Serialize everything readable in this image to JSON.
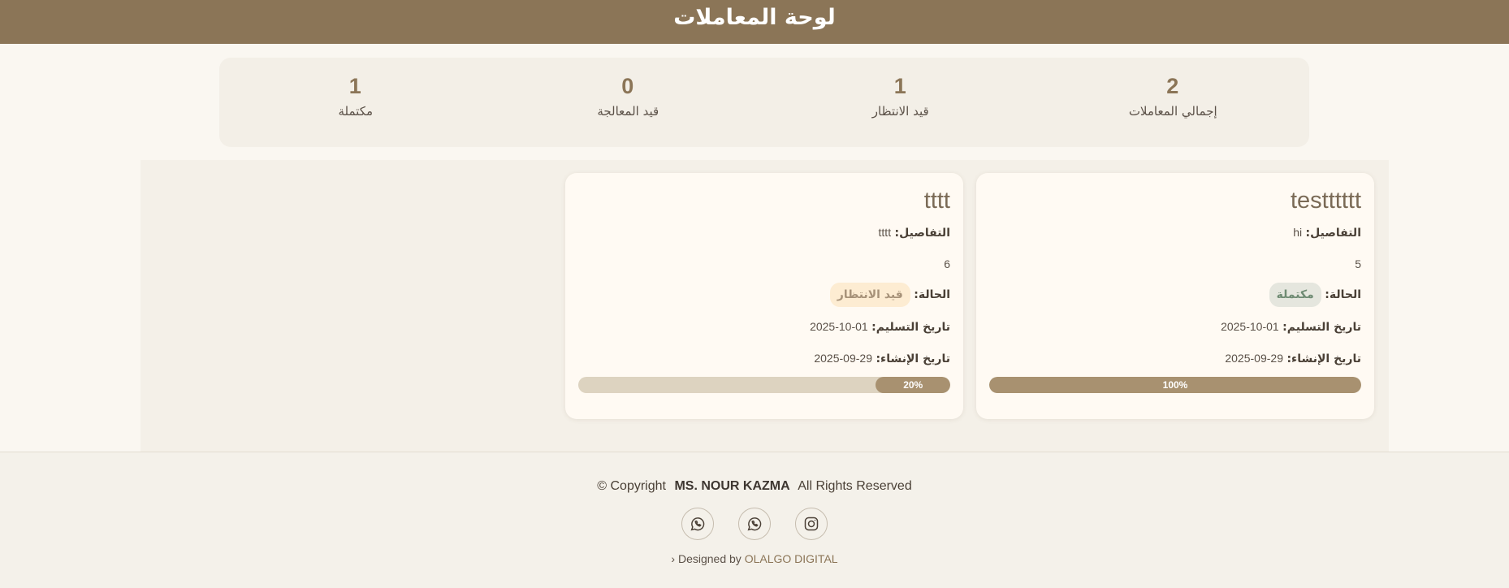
{
  "header": {
    "title": "لوحة المعاملات"
  },
  "stats": [
    {
      "value": "2",
      "label": "إجمالي المعاملات"
    },
    {
      "value": "1",
      "label": "قيد الانتظار"
    },
    {
      "value": "0",
      "label": "قيد المعالجة"
    },
    {
      "value": "1",
      "label": "مكتملة"
    }
  ],
  "cards": [
    {
      "title": "testttttt",
      "details_label": "التفاصيل:",
      "details_value": "hi",
      "number": "5",
      "status_label": "الحالة:",
      "status": "مكتملة",
      "status_kind": "done",
      "delivery_label": "تاريخ التسليم:",
      "delivery_date": "01-10-2025",
      "created_label": "تاريخ الإنشاء:",
      "created_date": "29-09-2025",
      "progress": 100,
      "progress_text": "100%"
    },
    {
      "title": "tttt",
      "details_label": "التفاصيل:",
      "details_value": "tttt",
      "number": "6",
      "status_label": "الحالة:",
      "status": "قيد الانتظار",
      "status_kind": "wait",
      "delivery_label": "تاريخ التسليم:",
      "delivery_date": "01-10-2025",
      "created_label": "تاريخ الإنشاء:",
      "created_date": "29-09-2025",
      "progress": 20,
      "progress_text": "20%"
    }
  ],
  "footer": {
    "copyright_prefix": "© Copyright",
    "owner": "MS. NOUR KAZMA",
    "rights": "All Rights Reserved",
    "designed_prefix": "› Designed by",
    "designer": "OLALGO DIGITAL",
    "socials": [
      "whatsapp-icon",
      "whatsapp-icon",
      "instagram-icon"
    ]
  },
  "colors": {
    "brand": "#8b7557",
    "progress": "#a89170",
    "done_text": "#6f8b73",
    "wait_bg": "#fdecd2"
  }
}
